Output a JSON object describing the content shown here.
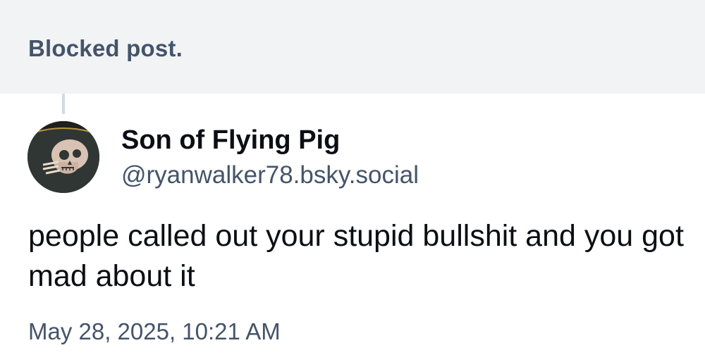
{
  "blocked": {
    "label": "Blocked post."
  },
  "post": {
    "author": {
      "display_name": "Son of Flying Pig",
      "handle": "@ryanwalker78.bsky.social",
      "avatar_icon": "skull-avatar-icon"
    },
    "text": "people called out your stupid bullshit and you got mad about it",
    "timestamp": "May 28, 2025, 10:21 AM"
  },
  "colors": {
    "banner_bg": "#f1f3f5",
    "muted_text": "#44546a",
    "primary_text": "#0b0f14",
    "thread_line": "#d4dbe2"
  }
}
